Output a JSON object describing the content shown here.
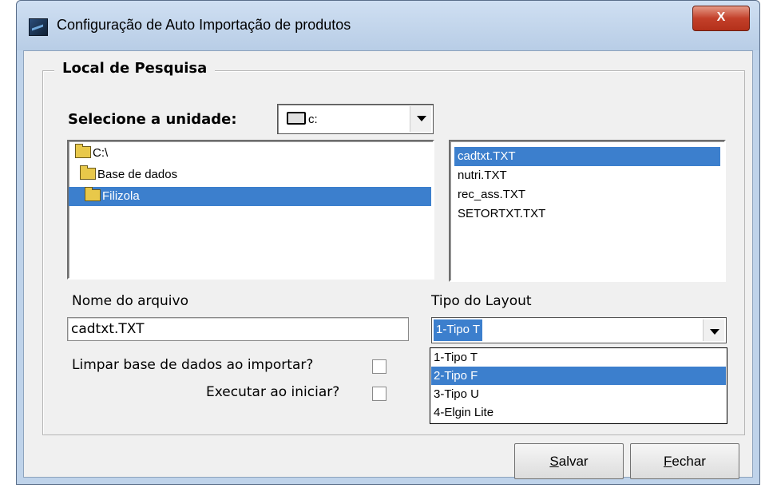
{
  "window": {
    "title": "Configuração de Auto Importação de produtos",
    "close_label": "X"
  },
  "group": {
    "legend": "Local de Pesquisa"
  },
  "drive": {
    "label": "Selecione a unidade:",
    "value": "c:"
  },
  "directories": [
    {
      "label": "C:\\",
      "selected": false
    },
    {
      "label": "Base de dados",
      "selected": false
    },
    {
      "label": "Filizola",
      "selected": true
    }
  ],
  "files": [
    {
      "label": "cadtxt.TXT",
      "selected": true
    },
    {
      "label": "nutri.TXT",
      "selected": false
    },
    {
      "label": "rec_ass.TXT",
      "selected": false
    },
    {
      "label": "SETORTXT.TXT",
      "selected": false
    }
  ],
  "filename": {
    "label": "Nome do arquivo",
    "value": "cadtxt.TXT"
  },
  "layout": {
    "label": "Tipo do Layout",
    "value": "1-Tipo T",
    "options": [
      {
        "label": "1-Tipo T",
        "highlighted": false
      },
      {
        "label": "2-Tipo F",
        "highlighted": true
      },
      {
        "label": "3-Tipo U",
        "highlighted": false
      },
      {
        "label": "4-Elgin Lite",
        "highlighted": false
      }
    ]
  },
  "options": {
    "clear_db_label": "Limpar base de dados ao importar?",
    "clear_db_checked": false,
    "run_on_start_label": "Executar ao iniciar?",
    "run_on_start_checked": false
  },
  "buttons": {
    "save_first": "S",
    "save_rest": "alvar",
    "close_first": "F",
    "close_rest": "echar"
  },
  "colors": {
    "selection": "#3c7fcd",
    "window_frame": "#bfd3ea",
    "close_button": "#c3402a"
  }
}
